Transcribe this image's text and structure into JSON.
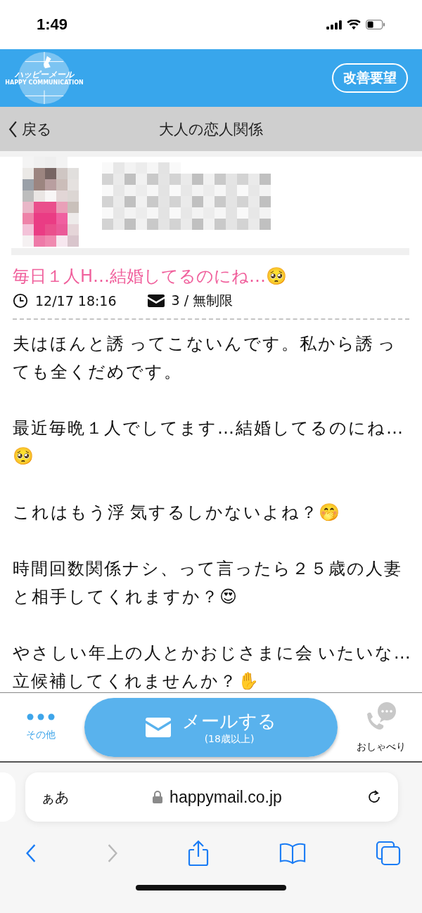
{
  "status_bar": {
    "time": "1:49"
  },
  "header": {
    "logo_title": "ハッピーメール",
    "logo_subtitle": "HAPPY COMMUNICATION",
    "feedback_button": "改善要望"
  },
  "nav": {
    "back": "戻る",
    "title": "大人の恋人関係"
  },
  "post": {
    "title": "毎日１人H…結婚してるのにね…🥺",
    "date": "12/17 18:16",
    "mail_count": "3 / 無制限",
    "paragraphs": [
      {
        "text": "夫はほんと誘 ってこないんです。私から誘 っても全くだめです。"
      },
      {
        "text": "最近毎晩１人でしてます…結婚してるのにね…🥺"
      },
      {
        "text": "これはもう浮 気するしかないよね？🤭"
      },
      {
        "text": "時間回数関係ナシ、って言ったら２５歳の人妻と相手してくれますか？😍"
      },
      {
        "text": "やさしい年上の人とかおじさまに会 いたいな…立候補してくれませんか？✋"
      }
    ]
  },
  "action_bar": {
    "more": "その他",
    "mail_button": "メールする",
    "mail_note": "(18歳以上)",
    "chat": "おしゃべり"
  },
  "browser": {
    "text_size": "ぁあ",
    "url": "happymail.co.jp",
    "forward_disabled": true
  }
}
